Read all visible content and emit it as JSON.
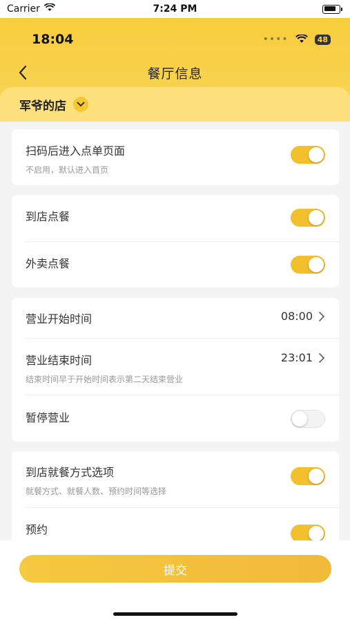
{
  "sim_status": {
    "carrier": "Carrier",
    "time": "7:24 PM"
  },
  "inner_status": {
    "time": "18:04",
    "dots": "••••",
    "battery": "48"
  },
  "nav": {
    "back": "‹",
    "title": "餐厅信息"
  },
  "store": {
    "name": "军爷的店",
    "chevron": "⌵"
  },
  "sections": [
    {
      "rows": [
        {
          "title": "扫码后进入点单页面",
          "subtitle": "不启用，默认进入首页",
          "toggle": true
        }
      ]
    },
    {
      "rows": [
        {
          "title": "到店点餐",
          "toggle": true
        },
        {
          "title": "外卖点餐",
          "toggle": true
        }
      ]
    },
    {
      "rows": [
        {
          "title": "营业开始时间",
          "value": "08:00"
        },
        {
          "title": "营业结束时间",
          "value": "23:01",
          "subtitle": "结束时间早于开始时间表示第二天结束营业"
        },
        {
          "title": "暂停营业",
          "toggle": false
        }
      ]
    },
    {
      "rows": [
        {
          "title": "到店就餐方式选项",
          "subtitle": "就餐方式、就餐人数、预约时间等选择",
          "toggle": true
        },
        {
          "title": "预约",
          "toggle": true
        }
      ]
    }
  ],
  "submit_label": "提交",
  "colors": {
    "accent": "#f3c02d",
    "header": "#f7cd3d"
  }
}
